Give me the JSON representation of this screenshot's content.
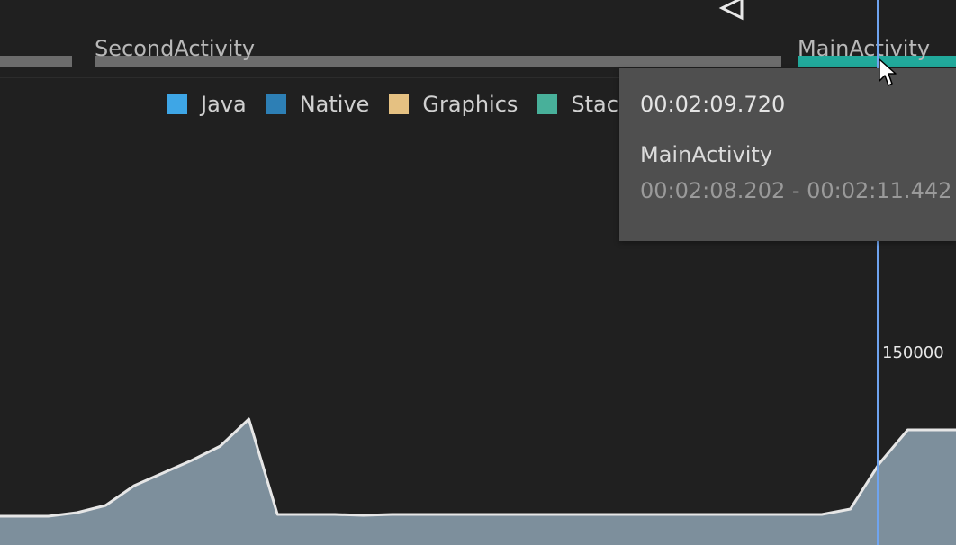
{
  "activities": [
    {
      "label": "",
      "state": "inactive"
    },
    {
      "label": "SecondActivity",
      "state": "inactive"
    },
    {
      "label": "MainActivity",
      "state": "active"
    }
  ],
  "legend": [
    {
      "label": "Java",
      "color": "#3ea6e6"
    },
    {
      "label": "Native",
      "color": "#2d7fb5"
    },
    {
      "label": "Graphics",
      "color": "#e5c182"
    },
    {
      "label": "Stack",
      "color": "#48b09a"
    }
  ],
  "tooltip": {
    "time": "00:02:09.720",
    "activity": "MainActivity",
    "range": "00:02:08.202 - 00:02:11.442"
  },
  "scale": {
    "label": "150000"
  },
  "chart_data": {
    "type": "area",
    "title": "",
    "xlabel": "",
    "ylabel": "",
    "legend": "top",
    "ylim": [
      0,
      150000
    ],
    "cursor_time": "00:02:09.720",
    "series": [
      {
        "name": "Java",
        "color": "#7d8f9c",
        "values": [
          1430,
          1430,
          1430,
          4280,
          10000,
          25700,
          35700,
          45700,
          57100,
          78600,
          2860,
          2860,
          2860,
          2140,
          2860,
          2860,
          2860,
          2860,
          2860,
          2860,
          2860,
          2860,
          2860,
          2860,
          2860,
          2860,
          2860,
          2860,
          2860,
          2860,
          7140,
          42900,
          70000,
          70000,
          70000
        ]
      }
    ]
  }
}
